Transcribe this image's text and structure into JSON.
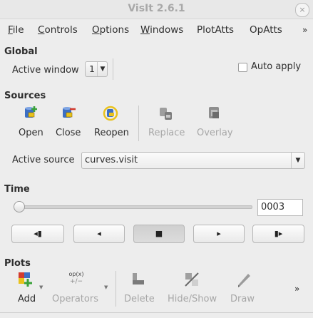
{
  "window": {
    "title": "VisIt 2.6.1",
    "close_glyph": "×"
  },
  "menu": {
    "items": [
      {
        "label": "File",
        "mnemonic": "F",
        "rest": "ile"
      },
      {
        "label": "Controls",
        "mnemonic": "C",
        "rest": "ontrols"
      },
      {
        "label": "Options",
        "mnemonic": "O",
        "rest": "ptions"
      },
      {
        "label": "Windows",
        "mnemonic": "W",
        "rest": "indows"
      },
      {
        "label": "PlotAtts",
        "mnemonic": "",
        "rest": "PlotAtts"
      },
      {
        "label": "OpAtts",
        "mnemonic": "",
        "rest": "OpAtts"
      }
    ],
    "overflow": "»"
  },
  "global": {
    "heading": "Global",
    "active_window_label": "Active window",
    "active_window_value": "1",
    "auto_apply_label": "Auto apply",
    "auto_apply_checked": false
  },
  "sources": {
    "heading": "Sources",
    "buttons": [
      {
        "label": "Open",
        "enabled": true,
        "icon": "open-database-icon"
      },
      {
        "label": "Close",
        "enabled": true,
        "icon": "close-database-icon"
      },
      {
        "label": "Reopen",
        "enabled": true,
        "icon": "reopen-database-icon"
      },
      {
        "label": "Replace",
        "enabled": false,
        "icon": "replace-database-icon"
      },
      {
        "label": "Overlay",
        "enabled": false,
        "icon": "overlay-database-icon"
      }
    ],
    "active_source_label": "Active source",
    "active_source_value": "curves.visit"
  },
  "time": {
    "heading": "Time",
    "slider_fraction": 0.0,
    "state_value": "0003",
    "vcr": [
      "◂▮",
      "◂",
      "■",
      "▸",
      "▮▸"
    ]
  },
  "plots": {
    "heading": "Plots",
    "buttons": [
      {
        "label": "Add",
        "enabled": true,
        "icon": "add-plot-icon"
      },
      {
        "label": "Operators",
        "enabled": false,
        "icon": "operators-icon",
        "icon_text": "op(x)"
      },
      {
        "label": "Delete",
        "enabled": false,
        "icon": "delete-plot-icon"
      },
      {
        "label": "Hide/Show",
        "enabled": false,
        "icon": "hide-show-icon"
      },
      {
        "label": "Draw",
        "enabled": false,
        "icon": "draw-icon"
      }
    ],
    "overflow": "»"
  },
  "colors": {
    "window_bg": "#ededed",
    "disabled_text": "#a7a7a7",
    "accent_blue": "#3c6fc4",
    "accent_red": "#d23b2e",
    "accent_yellow": "#e9c21c",
    "accent_green": "#3aa23a"
  }
}
